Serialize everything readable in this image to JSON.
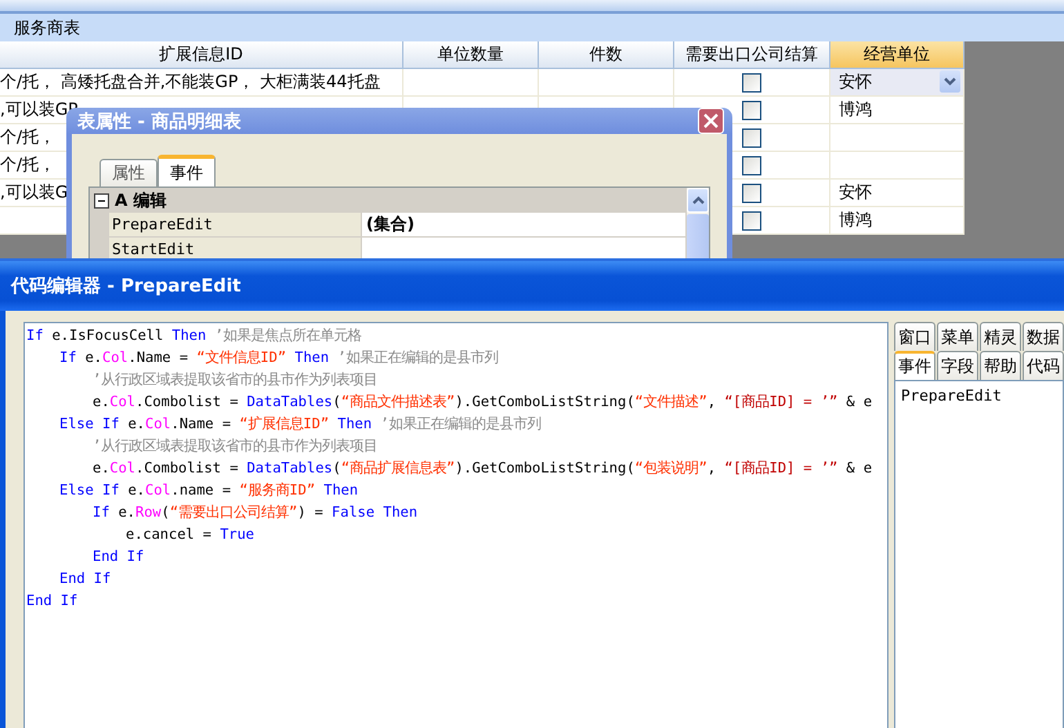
{
  "form": {
    "title": "服务商表"
  },
  "table": {
    "columns": [
      {
        "label": "扩展信息ID",
        "selected": false
      },
      {
        "label": "单位数量",
        "selected": false
      },
      {
        "label": "件数",
        "selected": false
      },
      {
        "label": "需要出口公司结算",
        "selected": false
      },
      {
        "label": "经营单位",
        "selected": true
      }
    ],
    "rows": [
      {
        "extension_info": "个/托， 高矮托盘合并,不能装GP， 大柜满装44托盘",
        "checked": false,
        "business_unit": "安怀",
        "focused": true
      },
      {
        "extension_info": ",可以装GP",
        "checked": false,
        "business_unit": "博鸿",
        "focused": false
      },
      {
        "extension_info": "个/托，",
        "checked": false,
        "focused": false
      },
      {
        "extension_info": "个/托，",
        "checked": false,
        "focused": false
      },
      {
        "extension_info": ",可以装G",
        "checked": false,
        "business_unit": "安怀",
        "focused": false
      },
      {
        "checked": false,
        "business_unit": "博鸿",
        "focused": false
      }
    ]
  },
  "properties_dialog": {
    "title": "表属性 - 商品明细表",
    "tabs": [
      {
        "label": "属性",
        "selected": false
      },
      {
        "label": "事件",
        "selected": true
      }
    ],
    "group": {
      "label": "A 编辑",
      "expanded": true
    },
    "properties": [
      {
        "name": "PrepareEdit",
        "value": "(集合)"
      },
      {
        "name": "StartEdit"
      }
    ]
  },
  "code_editor": {
    "title": "代码编辑器 - PrepareEdit",
    "code": [
      {
        "tokens": [
          {
            "kind": "keyword",
            "text": "If"
          },
          {
            "kind": "plain",
            "text": " e.IsFocusCell "
          },
          {
            "kind": "keyword",
            "text": "Then"
          },
          {
            "kind": "comment",
            "text": " ’如果是焦点所在单元格"
          }
        ],
        "children": [
          {
            "tokens": [
              {
                "kind": "keyword",
                "text": "If"
              },
              {
                "kind": "plain",
                "text": " e."
              },
              {
                "kind": "object",
                "text": "Col"
              },
              {
                "kind": "plain",
                "text": ".Name = "
              },
              {
                "kind": "string",
                "text": "“文件信息ID”"
              },
              {
                "kind": "keyword",
                "text": " Then"
              },
              {
                "kind": "comment",
                "text": " ’如果正在编辑的是县市列"
              }
            ],
            "children": [
              {
                "tokens": [
                  {
                    "kind": "comment",
                    "text": "’从行政区域表提取该省市的县市作为列表项目"
                  }
                ]
              },
              {
                "tokens": [
                  {
                    "kind": "plain",
                    "text": "e."
                  },
                  {
                    "kind": "object",
                    "text": "Col"
                  },
                  {
                    "kind": "plain",
                    "text": ".Combolist = "
                  },
                  {
                    "kind": "keyword",
                    "text": "DataTables"
                  },
                  {
                    "kind": "plain",
                    "text": "("
                  },
                  {
                    "kind": "string",
                    "text": "“商品文件描述表”"
                  },
                  {
                    "kind": "plain",
                    "text": ").GetComboListString("
                  },
                  {
                    "kind": "string",
                    "text": "“文件描述”"
                  },
                  {
                    "kind": "plain",
                    "text": ", "
                  },
                  {
                    "kind": "filter",
                    "text": "“[商品ID] = ’”"
                  },
                  {
                    "kind": "plain",
                    "text": " & e"
                  }
                ]
              }
            ]
          },
          {
            "tokens": [
              {
                "kind": "keyword",
                "text": "Else If"
              },
              {
                "kind": "plain",
                "text": " e."
              },
              {
                "kind": "object",
                "text": "Col"
              },
              {
                "kind": "plain",
                "text": ".Name = "
              },
              {
                "kind": "string",
                "text": "“扩展信息ID”"
              },
              {
                "kind": "keyword",
                "text": " Then"
              },
              {
                "kind": "comment",
                "text": " ’如果正在编辑的是县市列"
              }
            ],
            "children": [
              {
                "tokens": [
                  {
                    "kind": "comment",
                    "text": "’从行政区域表提取该省市的县市作为列表项目"
                  }
                ]
              },
              {
                "tokens": [
                  {
                    "kind": "plain",
                    "text": "e."
                  },
                  {
                    "kind": "object",
                    "text": "Col"
                  },
                  {
                    "kind": "plain",
                    "text": ".Combolist = "
                  },
                  {
                    "kind": "keyword",
                    "text": "DataTables"
                  },
                  {
                    "kind": "plain",
                    "text": "("
                  },
                  {
                    "kind": "string",
                    "text": "“商品扩展信息表”"
                  },
                  {
                    "kind": "plain",
                    "text": ").GetComboListString("
                  },
                  {
                    "kind": "string",
                    "text": "“包装说明”"
                  },
                  {
                    "kind": "plain",
                    "text": ", "
                  },
                  {
                    "kind": "filter",
                    "text": "“[商品ID] = ’”"
                  },
                  {
                    "kind": "plain",
                    "text": " & e"
                  }
                ]
              }
            ]
          },
          {
            "tokens": [
              {
                "kind": "keyword",
                "text": "Else If"
              },
              {
                "kind": "plain",
                "text": " e."
              },
              {
                "kind": "object",
                "text": "Col"
              },
              {
                "kind": "plain",
                "text": ".name = "
              },
              {
                "kind": "string",
                "text": "“服务商ID”"
              },
              {
                "kind": "keyword",
                "text": " Then"
              }
            ],
            "children": [
              {
                "tokens": [
                  {
                    "kind": "keyword",
                    "text": "If"
                  },
                  {
                    "kind": "plain",
                    "text": " e."
                  },
                  {
                    "kind": "object",
                    "text": "Row"
                  },
                  {
                    "kind": "plain",
                    "text": "("
                  },
                  {
                    "kind": "string",
                    "text": "“需要出口公司结算”"
                  },
                  {
                    "kind": "plain",
                    "text": ") = "
                  },
                  {
                    "kind": "keyword",
                    "text": "False"
                  },
                  {
                    "kind": "keyword",
                    "text": " Then"
                  }
                ],
                "children": [
                  {
                    "tokens": [
                      {
                        "kind": "plain",
                        "text": "e.cancel = "
                      },
                      {
                        "kind": "keyword",
                        "text": "True"
                      }
                    ]
                  }
                ]
              },
              {
                "tokens": [
                  {
                    "kind": "keyword",
                    "text": "End If"
                  }
                ]
              }
            ]
          },
          {
            "tokens": [
              {
                "kind": "keyword",
                "text": "End If"
              }
            ]
          }
        ]
      },
      {
        "tokens": [
          {
            "kind": "keyword",
            "text": "End If"
          }
        ]
      }
    ],
    "side_tabs": [
      [
        {
          "label": "窗口",
          "selected": false
        },
        {
          "label": "菜单",
          "selected": false
        },
        {
          "label": "精灵",
          "selected": false
        },
        {
          "label": "数据",
          "selected": false
        }
      ],
      [
        {
          "label": "事件",
          "selected": true
        },
        {
          "label": "字段",
          "selected": false
        },
        {
          "label": "帮助",
          "selected": false
        },
        {
          "label": "代码",
          "selected": false
        }
      ]
    ],
    "event_list": [
      "PrepareEdit"
    ]
  }
}
